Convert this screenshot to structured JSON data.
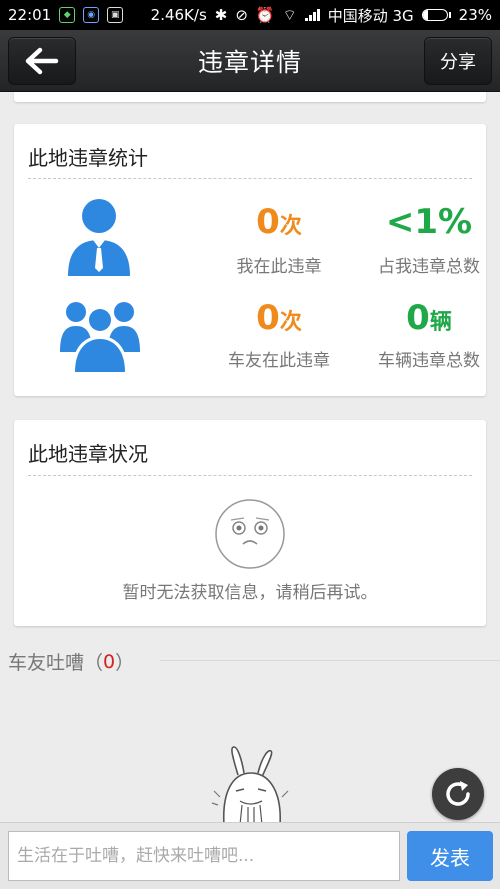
{
  "status_bar": {
    "time": "22:01",
    "speed": "2.46K/s",
    "carrier": "中国移动 3G",
    "battery": "23%",
    "battery_level": 0.23
  },
  "header": {
    "title": "违章详情",
    "share_label": "分享"
  },
  "stats_card": {
    "title": "此地违章统计",
    "my_count": "0",
    "my_count_unit": "次",
    "my_count_label": "我在此违章",
    "my_share": "<1%",
    "my_share_label": "占我违章总数",
    "friends_count": "0",
    "friends_count_unit": "次",
    "friends_count_label": "车友在此违章",
    "vehicles": "0",
    "vehicles_unit": "辆",
    "vehicles_label": "车辆违章总数"
  },
  "status_card": {
    "title": "此地违章状况",
    "message": "暂时无法获取信息，请稍后再试。"
  },
  "comments": {
    "label": "车友吐嘈",
    "open_paren": "（",
    "count": "0",
    "close_paren": "）"
  },
  "composer": {
    "placeholder": "生活在于吐嘈，赶快来吐嘈吧...",
    "send_label": "发表"
  },
  "colors": {
    "orange": "#f08a1c",
    "green": "#1ea847",
    "icon_blue": "#2f88e0",
    "send_blue": "#3f8fe8"
  }
}
